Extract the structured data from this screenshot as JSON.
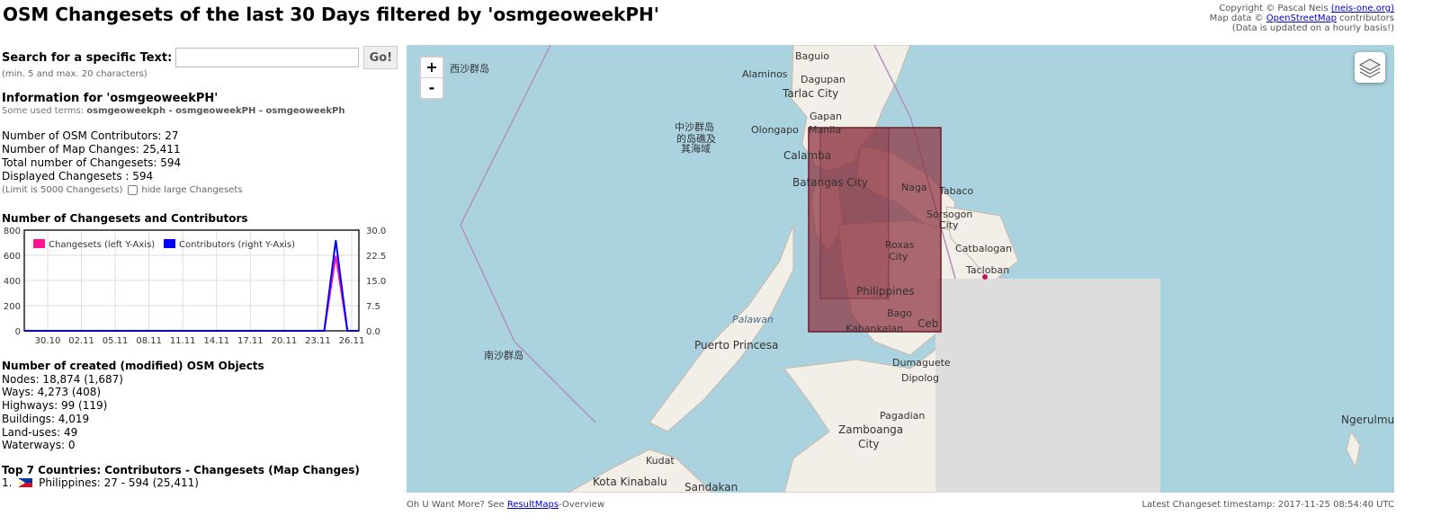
{
  "page": {
    "title": "OSM Changesets of the last 30 Days filtered by 'osmgeoweekPH'",
    "copyright_line1": "Copyright © Pascal Neis ",
    "copyright_link1": "(neis-one.org)",
    "copyright_line2_pre": "Map data © ",
    "copyright_link2": "OpenStreetMap",
    "copyright_line2_post": " contributors",
    "copyright_line3": "(Data is updated on a hourly basis!)"
  },
  "search": {
    "label": "Search for a specific Text:",
    "value": "",
    "placeholder": "",
    "button": "Go!",
    "hint": "(min. 5 and max. 20 characters)"
  },
  "info": {
    "title": "Information for 'osmgeoweekPH'",
    "terms_label": "Some used terms: ",
    "terms": "osmgeoweekph - osmgeoweekPH - osmgeoweekPh",
    "contributors": "Number of OSM Contributors: 27",
    "map_changes": "Number of Map Changes: 25,411",
    "total_changesets": "Total number of Changesets: 594",
    "displayed_changesets": "Displayed Changesets : 594",
    "limit": "(Limit is 5000 Changesets)",
    "hide_large": "hide large Changesets"
  },
  "chart_data": {
    "type": "line",
    "title": "Number of Changesets and Contributors",
    "x_tick_labels": [
      "30.10",
      "02.11",
      "05.11",
      "08.11",
      "11.11",
      "14.11",
      "17.11",
      "20.11",
      "23.11",
      "26.11"
    ],
    "ylim_left": [
      0,
      800
    ],
    "ylim_right": [
      0,
      30
    ],
    "left_ticks": [
      "800",
      "600",
      "400",
      "200",
      "0"
    ],
    "right_ticks": [
      "30.0",
      "22.5",
      "15.0",
      "7.5",
      "0.0"
    ],
    "grid": true,
    "legend_placement": "top-left",
    "series": [
      {
        "name": "Changesets (left Y-Axis)",
        "axis": "left",
        "color": "#ff1493",
        "values": [
          0,
          0,
          0,
          0,
          0,
          0,
          0,
          0,
          0,
          0,
          0,
          0,
          0,
          0,
          0,
          0,
          0,
          0,
          0,
          0,
          0,
          0,
          0,
          0,
          0,
          0,
          0,
          594,
          0,
          0
        ]
      },
      {
        "name": "Contributors (right Y-Axis)",
        "axis": "right",
        "color": "#0000ff",
        "values": [
          0,
          0,
          0,
          0,
          0,
          0,
          0,
          0,
          0,
          0,
          0,
          0,
          0,
          0,
          0,
          0,
          0,
          0,
          0,
          0,
          0,
          0,
          0,
          0,
          0,
          0,
          0,
          27,
          0,
          0
        ]
      }
    ]
  },
  "objects": {
    "title": "Number of created (modified) OSM Objects",
    "nodes": "Nodes: 18,874 (1,687)",
    "ways": "Ways: 4,273 (408)",
    "highways": "Highways: 99 (119)",
    "buildings": "Buildings: 4,019",
    "landuses": "Land-uses: 49",
    "waterways": "Waterways: 0"
  },
  "countries": {
    "title": "Top 7 Countries: Contributors - Changesets (Map Changes)",
    "rank": "1.",
    "entry": "Philippines: 27 - 594 (25,411)",
    "flag_icon": "philippines-flag-icon"
  },
  "map": {
    "zoom_in": "+",
    "zoom_out": "-",
    "layers_icon": "layers-icon",
    "colors": {
      "sea": "#aad3df",
      "land": "#f2efe9",
      "changeset_box": "#8b2e3a",
      "nodata": "#dddddd"
    },
    "labels": {
      "baguio": "Baguio",
      "alaminos": "Alaminos",
      "dagupan": "Dagupan",
      "tarlac": "Tarlac City",
      "gapan": "Gapan",
      "olongapo": "Olongapo",
      "manila": "Manila",
      "calamba": "Calamba",
      "batangas": "Batangas City",
      "naga": "Naga",
      "tabaco": "Tabaco",
      "sorsogon1": "Sorsogon",
      "sorsogon2": "City",
      "catbalogan": "Catbalogan",
      "tacloban": "Tacloban",
      "roxas1": "Roxas",
      "roxas2": "City",
      "philippines": "Philippines",
      "bago": "Bago",
      "kabankalan": "Kabankalan",
      "cebu": "Ceb",
      "palawan": "Palawan",
      "puerto": "Puerto Princesa",
      "dumaguete": "Dumaguete",
      "dipolog": "Dipolog",
      "pagadian": "Pagadian",
      "zamboanga1": "Zamboanga",
      "zamboanga2": "City",
      "kudat": "Kudat",
      "kota": "Kota Kinabalu",
      "sandakan": "Sandakan",
      "ngerulmud": "Ngerulmud",
      "paracel": "西沙群岛",
      "spratly": "南沙群岛",
      "zhongsha1": "中沙群岛",
      "zhongsha2": "的岛礁及",
      "zhongsha3": "其海域"
    }
  },
  "footer": {
    "more_pre": "Oh U Want More? See ",
    "more_link": "ResultMaps",
    "more_post": "-Overview",
    "timestamp": "Latest Changeset timestamp: 2017-11-25 08:54:40 UTC"
  }
}
